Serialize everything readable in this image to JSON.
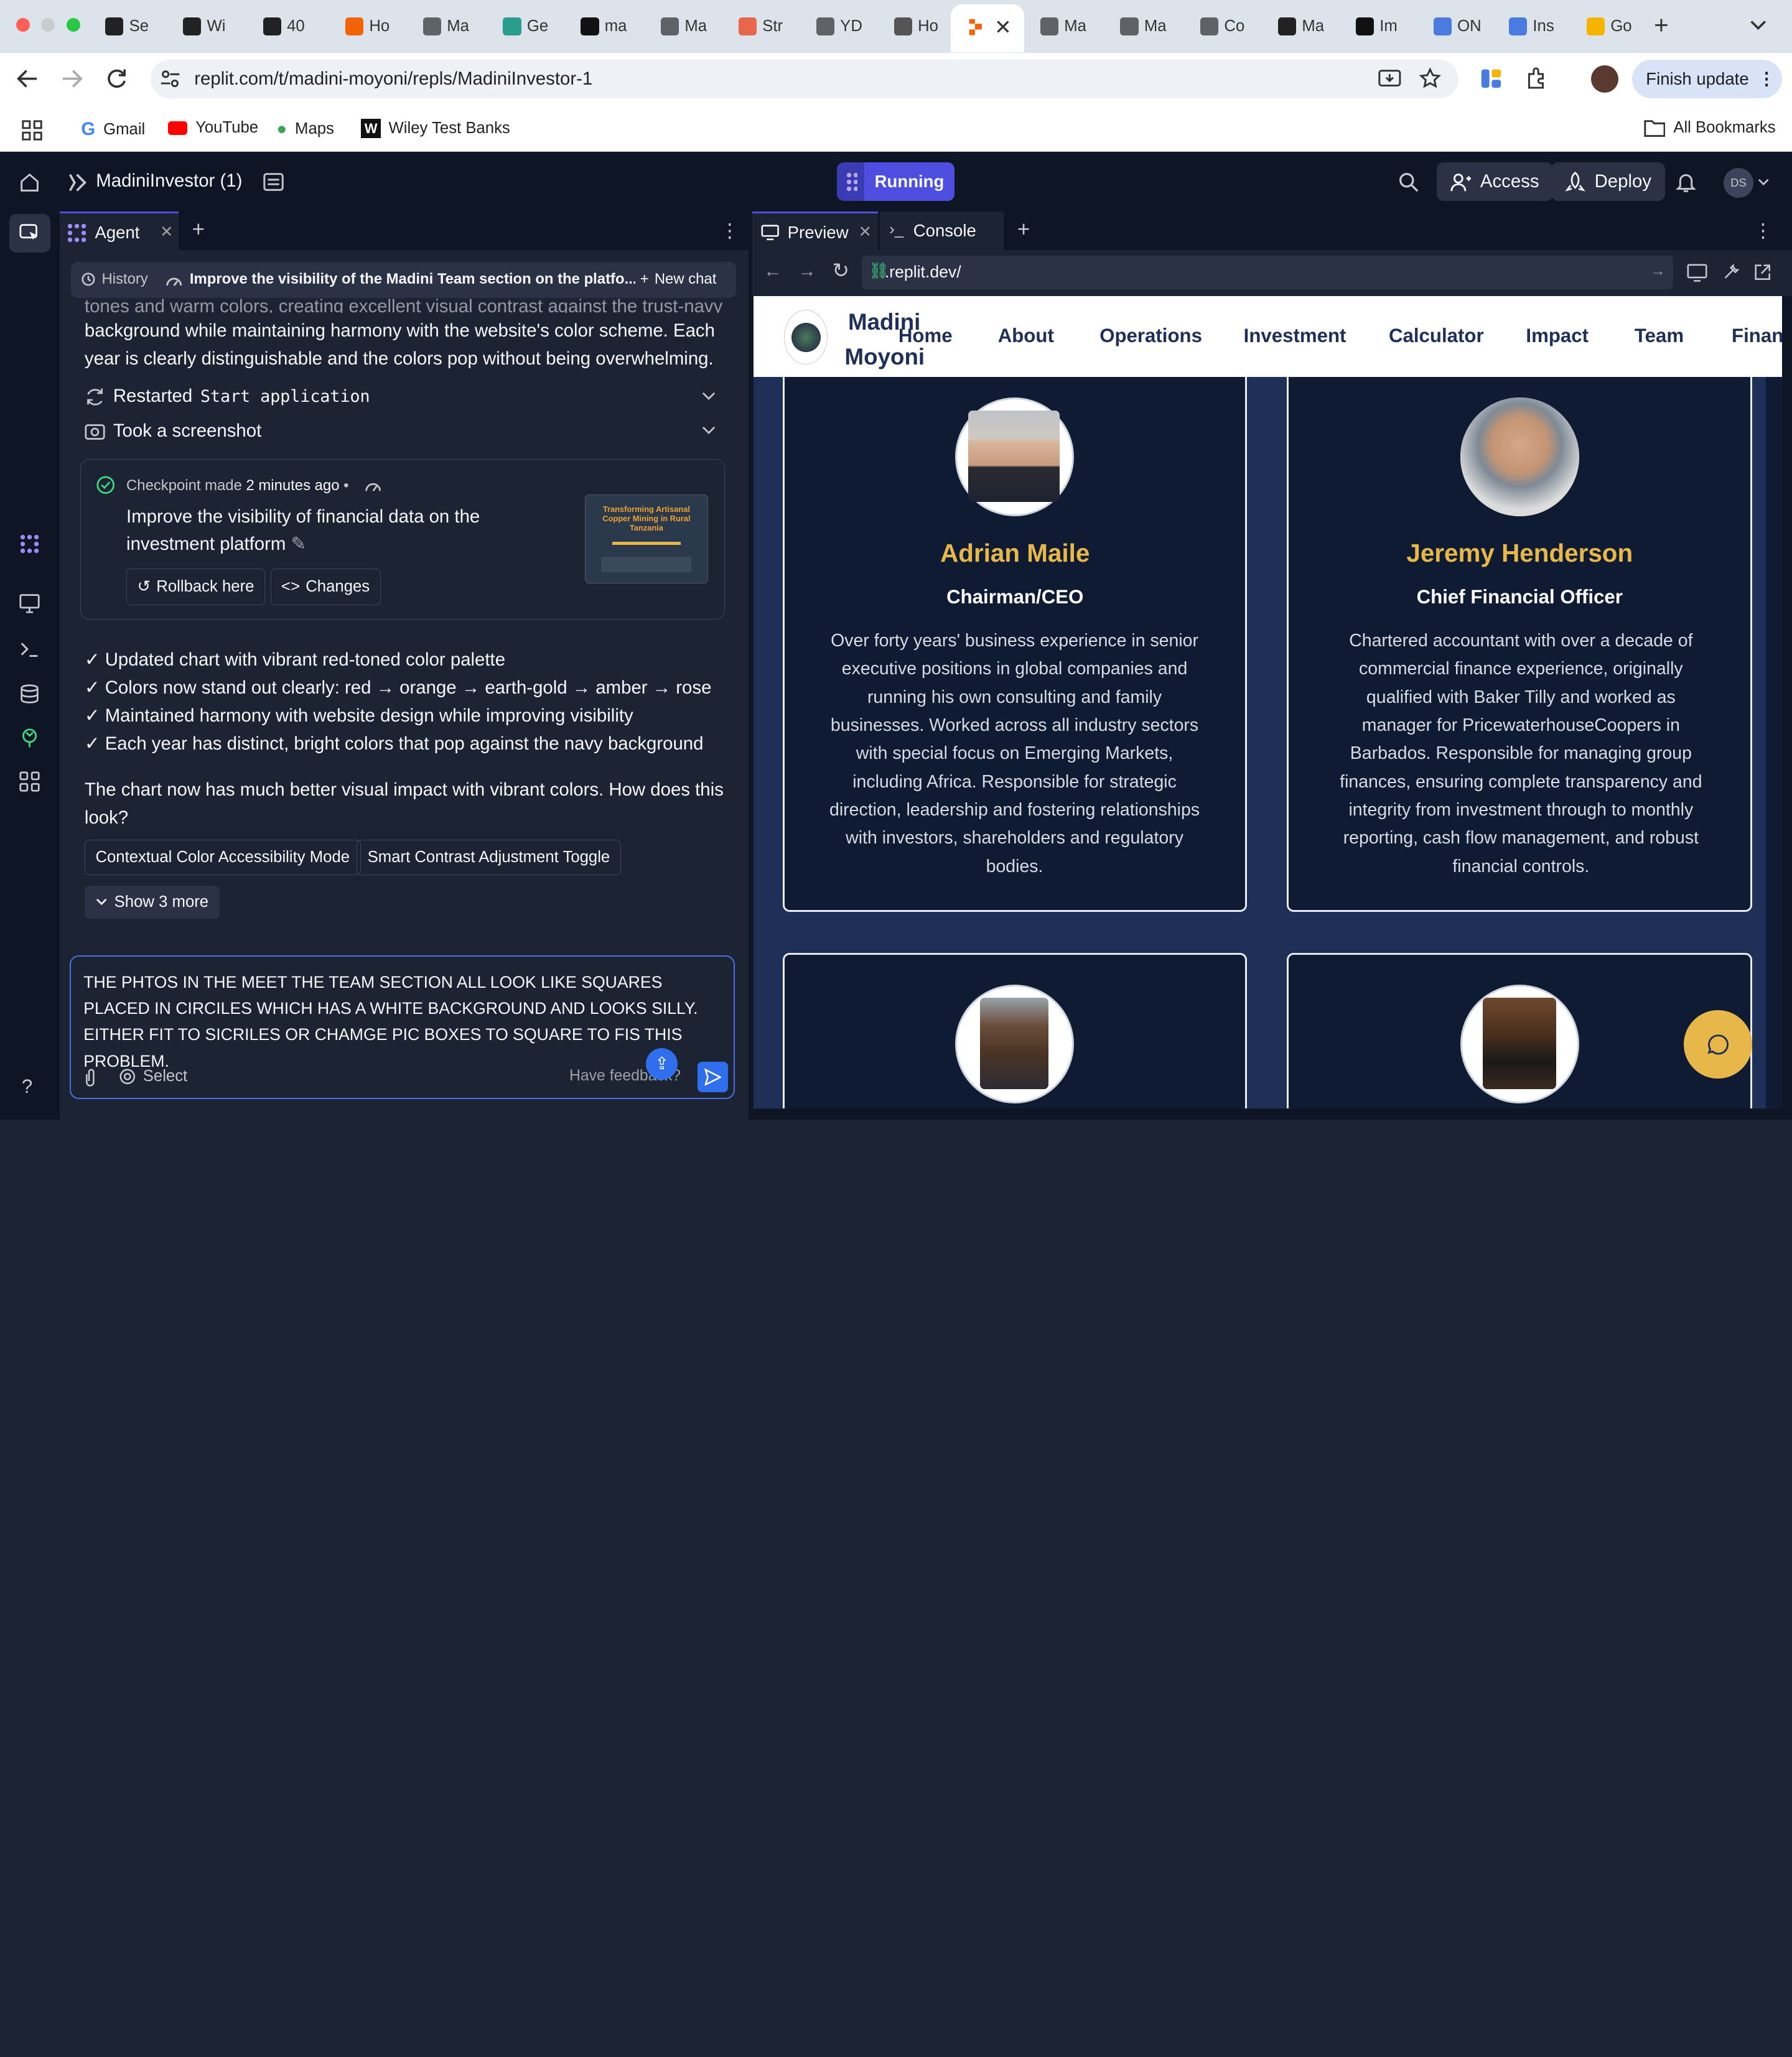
{
  "browser": {
    "tabs": [
      {
        "label": "Se",
        "favicon_color": "#222"
      },
      {
        "label": "Wi",
        "favicon_color": "#222"
      },
      {
        "label": "40",
        "favicon_color": "#222"
      },
      {
        "label": "Ho",
        "favicon_color": "#f26207"
      },
      {
        "label": "Ma",
        "favicon_color": "#5f6368"
      },
      {
        "label": "Ge",
        "favicon_color": "#2a9d8f"
      },
      {
        "label": "ma",
        "favicon_color": "#111"
      },
      {
        "label": "Ma",
        "favicon_color": "#5f6368"
      },
      {
        "label": "Str",
        "favicon_color": "#e8664a"
      },
      {
        "label": "YD",
        "favicon_color": "#5f6368"
      },
      {
        "label": "Ho",
        "favicon_color": "#555"
      },
      {
        "label": "Ma",
        "favicon_color": "#5f6368"
      },
      {
        "label": "Ma",
        "favicon_color": "#5f6368"
      },
      {
        "label": "Co",
        "favicon_color": "#5f6368"
      },
      {
        "label": "Ma",
        "favicon_color": "#222"
      },
      {
        "label": "Im",
        "favicon_color": "#111"
      },
      {
        "label": "ON",
        "favicon_color": "#4a7ce0"
      },
      {
        "label": "Ins",
        "favicon_color": "#4a7ce0"
      },
      {
        "label": "Go",
        "favicon_color": "#f4b400"
      }
    ],
    "url": "replit.com/t/madini-moyoni/repls/MadiniInvestor-1",
    "finish_update": "Finish update",
    "bookmarks": [
      "Gmail",
      "YouTube",
      "Maps",
      "Wiley Test Banks"
    ],
    "all_bookmarks": "All Bookmarks"
  },
  "replit": {
    "project_name": "MadiniInvestor (1)",
    "run_status": "Running",
    "access_label": "Access",
    "deploy_label": "Deploy",
    "avatar_initials": "DS",
    "agent_tab": "Agent",
    "history_label": "History",
    "chat_title": "Improve the visibility of the Madini Team section on the platfo...",
    "new_chat_label": "New chat",
    "message_top_partial": "tones and warm colors, creating excellent visual contrast against the trust-navy",
    "message_top_lines": [
      "background while maintaining harmony with the website's color scheme. Each",
      "year is clearly distinguishable and the colors pop without being overwhelming."
    ],
    "action_restarted_prefix": "Restarted",
    "action_restarted_code": "Start application",
    "action_screenshot": "Took a screenshot",
    "checkpoint": {
      "label": "Checkpoint made",
      "time": "2 minutes ago",
      "title": "Improve the visibility of financial data on the investment platform",
      "rollback": "Rollback here",
      "changes": "Changes",
      "thumb_title": "Transforming Artisanal Copper Mining in Rural Tanzania"
    },
    "checklist": [
      "✓ Updated chart with vibrant red-toned color palette",
      "✓ Colors now stand out clearly: red → orange → earth-gold → amber → rose",
      "✓ Maintained harmony with website design while improving visibility",
      "✓ Each year has distinct, bright colors that pop against the navy background"
    ],
    "closing": "The chart now has much better visual impact with vibrant colors. How does this look?",
    "suggestions": [
      "Contextual Color Accessibility Mode",
      "Smart Contrast Adjustment Toggle"
    ],
    "show_more": "Show 3 more",
    "input_text": "THE PHTOS IN THE MEET THE TEAM SECTION ALL LOOK LIKE SQUARES PLACED IN CIRCILES WHICH HAS A WHITE BACKGROUND AND LOOKS SILLY. EITHER FIT TO SICRILES OR CHAMGE PIC BOXES TO SQUARE TO FIS THIS PROBLEM.",
    "select_label": "Select",
    "feedback_label": "Have feedback?",
    "preview_tab": "Preview",
    "console_tab": "Console",
    "preview_url": ".replit.dev/"
  },
  "site": {
    "brand_line1": "Madini",
    "brand_line2": "Moyoni",
    "nav": [
      "Home",
      "About",
      "Operations",
      "Investment",
      "Calculator",
      "Impact",
      "Team",
      "Finance"
    ],
    "team": [
      {
        "name": "Adrian Maile",
        "role": "Chairman/CEO",
        "bio": [
          "Over forty years' business experience in senior",
          "executive positions in global companies and",
          "running his own consulting and family",
          "businesses. Worked across all industry sectors",
          "with special focus on Emerging Markets,",
          "including Africa. Responsible for strategic",
          "direction, leadership and fostering relationships",
          "with investors, shareholders and regulatory",
          "bodies."
        ]
      },
      {
        "name": "Jeremy Henderson",
        "role": "Chief Financial Officer",
        "bio": [
          "Chartered accountant with over a decade of",
          "commercial finance experience, originally",
          "qualified with Baker Tilly and worked as",
          "manager for PricewaterhouseCoopers in",
          "Barbados. Responsible for managing group",
          "finances, ensuring complete transparency and",
          "integrity from investment through to monthly",
          "reporting, cash flow management, and robust",
          "financial controls."
        ]
      }
    ]
  }
}
